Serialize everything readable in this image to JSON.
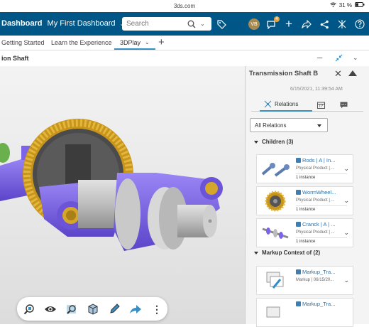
{
  "status_bar": {
    "url": "3ds.com",
    "battery": "31 %"
  },
  "header": {
    "app_title": "Dashboard",
    "dashboard_name": "My First Dashboard",
    "search_placeholder": "Search",
    "avatar_initials": "VB",
    "notification_count": "4"
  },
  "tabs": [
    {
      "label": "Getting Started"
    },
    {
      "label": "Learn the Experience"
    },
    {
      "label": "3DPlay"
    }
  ],
  "subbar": {
    "object_name": "ion Shaft"
  },
  "viewport": {
    "toolbar": [
      "zoom-fit-icon",
      "visibility-icon",
      "zoom-selection-icon",
      "cube-view-icon",
      "pencil-icon",
      "share-arrow-icon",
      "more-icon"
    ]
  },
  "panel": {
    "title": "Transmission Shaft B",
    "date": "6/15/2021, 11:39:54 AM",
    "tab_relations": "Relations",
    "filter": "All Relations",
    "children_section": "Children (3)",
    "children": [
      {
        "name": "Rods | A | In...",
        "type": "Physical Product | ...",
        "instances": "1 instance"
      },
      {
        "name": "WormWheel...",
        "type": "Physical Product | ...",
        "instances": "1 instance"
      },
      {
        "name": "Cranck | A | ...",
        "type": "Physical Product | ...",
        "instances": "1 instance"
      }
    ],
    "markup_section": "Markup Context of (2)",
    "markups": [
      {
        "name": "Markup_Tra...",
        "type": "Markup | 06/15/20..."
      },
      {
        "name": "Markup_Tra..."
      }
    ]
  },
  "colors": {
    "topbar": "#005686",
    "accent": "#368ec4",
    "gear": "#d4a62a",
    "purple": "#7d63e8"
  }
}
